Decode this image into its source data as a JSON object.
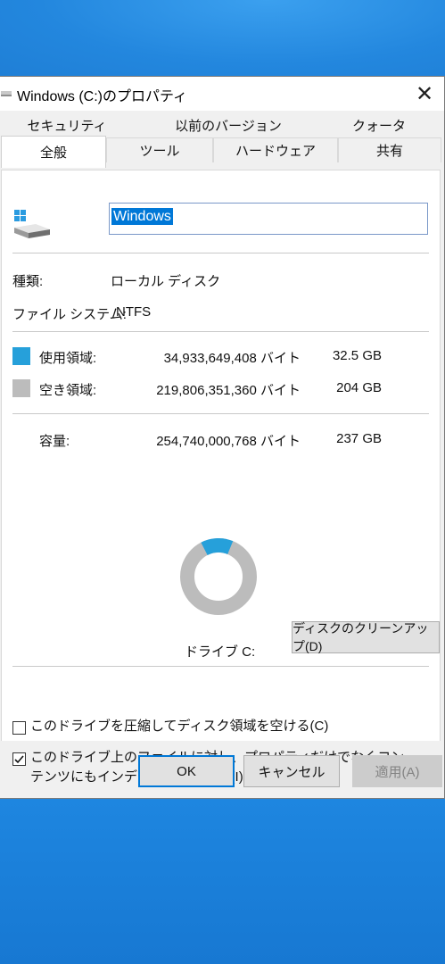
{
  "window": {
    "title": "Windows (C:)のプロパティ",
    "close_glyph": "✕"
  },
  "tabs": {
    "row1": [
      "セキュリティ",
      "以前のバージョン",
      "クォータ"
    ],
    "row2": [
      "全般",
      "ツール",
      "ハードウェア",
      "共有"
    ],
    "active": "全般"
  },
  "general": {
    "volume_name": "Windows",
    "type_label": "種類:",
    "type_value": "ローカル ディスク",
    "fs_label": "ファイル システム:",
    "fs_value": "NTFS",
    "used_label": "使用領域:",
    "used_bytes": "34,933,649,408 バイト",
    "used_gb": "32.5 GB",
    "free_label": "空き領域:",
    "free_bytes": "219,806,351,360 バイト",
    "free_gb": "204 GB",
    "capacity_label": "容量:",
    "capacity_bytes": "254,740,000,768 バイト",
    "capacity_gb": "237 GB",
    "drive_label": "ドライブ C:",
    "cleanup_button": "ディスクのクリーンアップ(D)",
    "used_fraction": 0.137,
    "colors": {
      "used": "#26a0da",
      "free": "#bcbcbc"
    }
  },
  "options": {
    "compress_label": "このドライブを圧縮してディスク領域を空ける(C)",
    "compress_checked": false,
    "index_label": "このドライブ上のファイルに対し、プロパティだけでなくコンテンツにもインデックスを付ける(I)",
    "index_checked": true
  },
  "buttons": {
    "ok": "OK",
    "cancel": "キャンセル",
    "apply": "適用(A)"
  }
}
